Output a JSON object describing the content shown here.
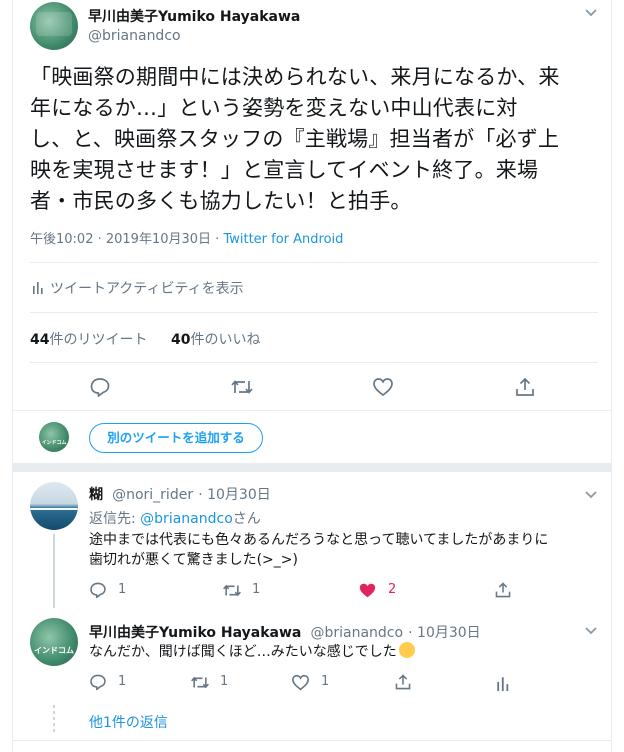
{
  "main_tweet": {
    "author_name": "早川由美子Yumiko Hayakawa",
    "author_handle": "@brianandco",
    "avatar_text": "",
    "text_lines": [
      "「映画祭の期間中には決められない、来月になるか、来",
      "年になるか…」という姿勢を変えない中山代表に対",
      "し、と、映画祭スタッフの『主戦場』担当者が「必ず上",
      "映を実現させます！」と宣言してイベント終了。来場",
      "者・市民の多くも協力したい！と拍手。"
    ],
    "time": "午後10:02 · 2019年10月30日 · ",
    "source": "Twitter for Android",
    "activity_label": "ツイートアクティビティを表示",
    "retweets_count": "44",
    "retweets_label": "件のリツイート",
    "likes_count": "40",
    "likes_label": "件のいいね"
  },
  "compose": {
    "add_tweet_label": "別のツイートを追加する",
    "avatar_text": "インドコム"
  },
  "replies": [
    {
      "author_name": "糊",
      "author_handle": "@nori_rider",
      "date": "10月30日",
      "replying_to_label": "返信先: ",
      "replying_to_handle": "@brianandco",
      "replying_to_suffix": "さん",
      "text_lines": [
        "途中までは代表にも色々あるんだろうなと思って聴いてましたがあまりに",
        "歯切れが悪くて驚きました(>_>)"
      ],
      "reply_count": "1",
      "retweet_count": "1",
      "like_count": "2",
      "liked": true
    },
    {
      "author_name": "早川由美子Yumiko Hayakawa",
      "author_handle": "@brianandco",
      "date": "10月30日",
      "avatar_text": "インドコム",
      "text": "なんだか、聞けば聞くほど…みたいな感じでした",
      "emoji": "😥",
      "reply_count": "1",
      "retweet_count": "1",
      "like_count": "1"
    }
  ],
  "more_replies_label": "他1件の返信",
  "colors": {
    "accent": "#1da1f2",
    "link": "#1b95e0",
    "muted": "#657786",
    "like_active": "#e0245e",
    "divider": "#e6ecf0"
  }
}
